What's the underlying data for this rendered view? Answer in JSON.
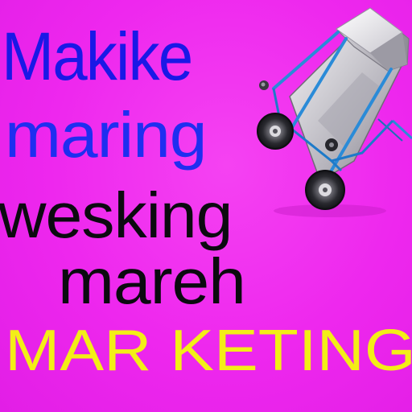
{
  "image": {
    "background_color": "#f12ef0"
  },
  "words": {
    "line1": "Makike",
    "line2": "maring",
    "line3": "wesking",
    "line4": "mareh",
    "line5": "MAR KETING"
  },
  "colors": {
    "blue_text": "#1a18e6",
    "black_text": "#0c0a10",
    "yellow_text": "#f3ee17",
    "cart_frame": "#2a8bd8"
  },
  "illustration": {
    "icon": "hand-truck-cart-icon"
  }
}
